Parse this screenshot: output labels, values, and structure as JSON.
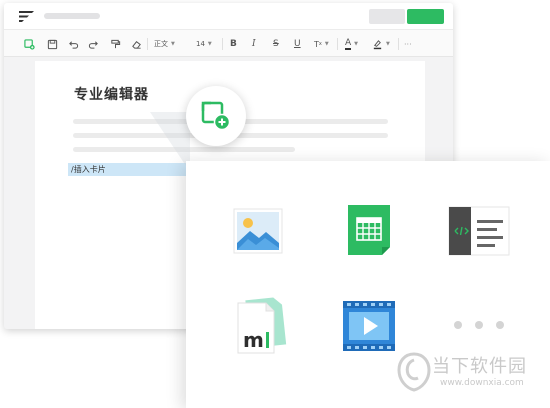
{
  "editor": {
    "toolbar": {
      "paragraph_style": "正文",
      "font_size": "14",
      "items": [
        "insert-card-icon",
        "save-icon",
        "undo-icon",
        "redo-icon",
        "format-painter-icon",
        "eraser-icon",
        "bold-icon",
        "italic-icon",
        "strikethrough-icon",
        "underline-icon",
        "superscript-icon",
        "font-color-icon",
        "highlight-icon",
        "more-icon"
      ]
    },
    "document": {
      "title": "专业编辑器",
      "command_text": "/插入卡片"
    },
    "colors": {
      "primary_green": "#2dbb62",
      "selection_blue": "#cde6f7"
    }
  },
  "card_panel": {
    "cards": [
      {
        "name": "image",
        "icon": "image-card-icon"
      },
      {
        "name": "table",
        "icon": "table-card-icon"
      },
      {
        "name": "code",
        "icon": "code-card-icon"
      },
      {
        "name": "markdown",
        "icon": "markdown-card-icon"
      },
      {
        "name": "video",
        "icon": "video-card-icon"
      }
    ],
    "more": "more-dots-icon"
  },
  "watermark": {
    "text": "当下软件园",
    "url": "www.downxia.com"
  }
}
